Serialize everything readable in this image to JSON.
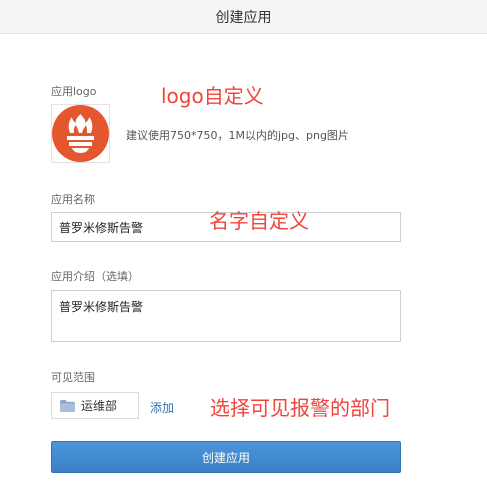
{
  "header": {
    "title": "创建应用"
  },
  "form": {
    "logo": {
      "label": "应用logo",
      "hint": "建议使用750*750，1M以内的jpg、png图片",
      "icon": "prometheus-flame-icon",
      "icon_bg": "#e4572e"
    },
    "name": {
      "label": "应用名称",
      "value": "普罗米修斯告警"
    },
    "intro": {
      "label": "应用介绍（选填）",
      "value": "普罗米修斯告警"
    },
    "visibility": {
      "label": "可见范围",
      "department": "运维部",
      "department_icon": "folder-icon",
      "add_label": "添加"
    },
    "submit_label": "创建应用"
  },
  "annotations": {
    "logo": "logo自定义",
    "name": "名字自定义",
    "department": "选择可见报警的部门",
    "color": "#f0443c"
  }
}
